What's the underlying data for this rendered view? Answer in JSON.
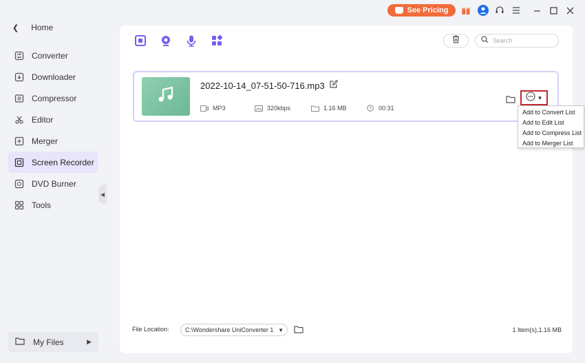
{
  "titlebar": {
    "pricing_label": "See Pricing",
    "accent_color": "#f26b3a"
  },
  "sidebar": {
    "home_label": "Home",
    "items": [
      {
        "label": "Converter",
        "icon": "converter-icon"
      },
      {
        "label": "Downloader",
        "icon": "downloader-icon"
      },
      {
        "label": "Compressor",
        "icon": "compressor-icon"
      },
      {
        "label": "Editor",
        "icon": "editor-icon"
      },
      {
        "label": "Merger",
        "icon": "merger-icon"
      },
      {
        "label": "Screen Recorder",
        "icon": "screen-recorder-icon",
        "active": true
      },
      {
        "label": "DVD Burner",
        "icon": "dvd-burner-icon"
      },
      {
        "label": "Tools",
        "icon": "tools-icon"
      }
    ],
    "my_files_label": "My Files",
    "active_bg": "#e8e4fb"
  },
  "toolbar": {
    "icons": [
      "screen-record-icon",
      "webcam-record-icon",
      "audio-record-icon",
      "apps-icon"
    ],
    "search_placeholder": "Search",
    "icon_color": "#7b5cf0"
  },
  "file": {
    "name": "2022-10-14_07-51-50-716.mp3",
    "format": "MP3",
    "bitrate": "320kbps",
    "size": "1.16 MB",
    "duration": "00:31"
  },
  "menu": {
    "items": [
      "Add to Convert List",
      "Add to Edit List",
      "Add to Compress List",
      "Add to Merger List"
    ]
  },
  "footer": {
    "location_label": "File Location:",
    "location_value": "C:\\Wondershare UniConverter 1",
    "summary": "1 Item(s),1.16 MB"
  }
}
